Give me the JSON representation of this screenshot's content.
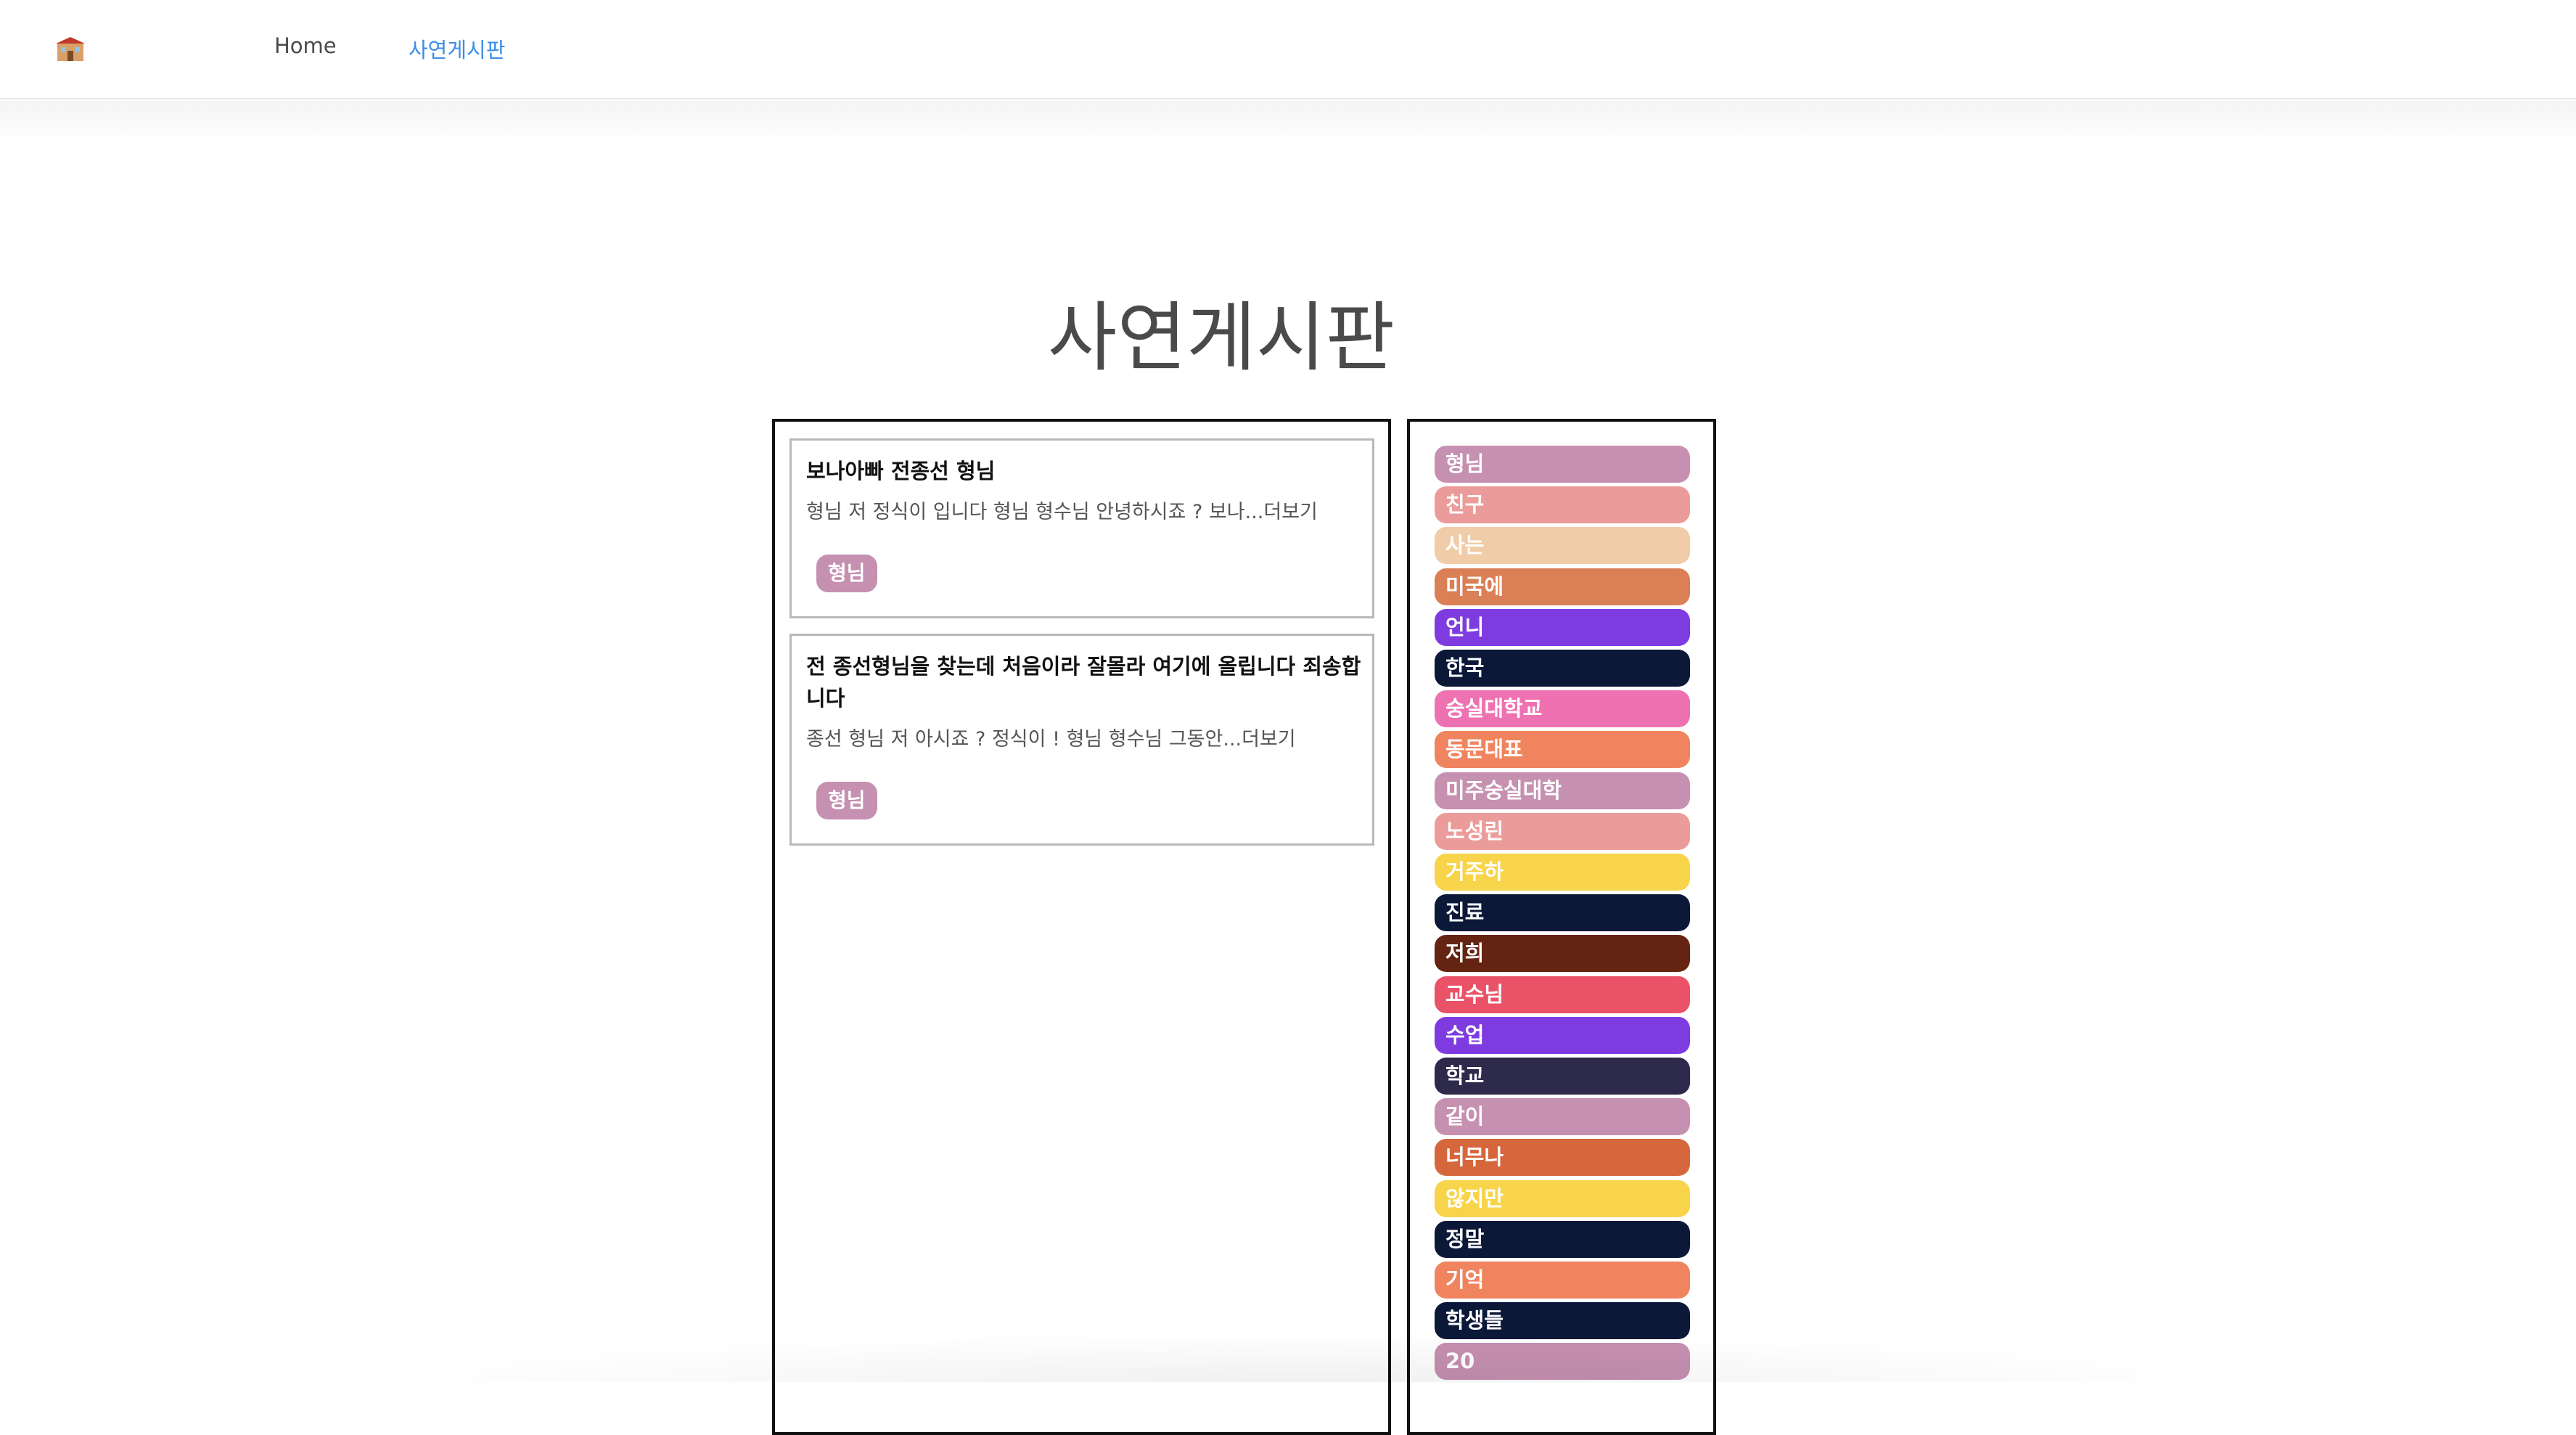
{
  "nav": {
    "logo_icon": "house-icon",
    "links": [
      "Home",
      "사연게시판"
    ],
    "active_color": "#3a8ee6"
  },
  "page": {
    "title": "사연게시판"
  },
  "posts": [
    {
      "title": "보나아빠 전종선 형님",
      "excerpt": "형님 저 정식이 입니다 형님 형수님 안녕하시죠 ? 보나...더보기",
      "tag": "형님"
    },
    {
      "title": "전 종선형님을 찾는데 처음이라 잘몰라 여기에 올립니다 죄송합니다",
      "excerpt": "종선 형님 저 아시죠 ? 정식이 ! 형님 형수님 그동안...더보기",
      "tag": "형님"
    }
  ],
  "tags": [
    {
      "label": "형님",
      "color": "#c690b0"
    },
    {
      "label": "친구",
      "color": "#eb9c9a"
    },
    {
      "label": "사는",
      "color": "#f0cca8"
    },
    {
      "label": "미국에",
      "color": "#da7f56"
    },
    {
      "label": "언니",
      "color": "#7e3ce0"
    },
    {
      "label": "한국",
      "color": "#0b1838"
    },
    {
      "label": "숭실대학교",
      "color": "#ee72b2"
    },
    {
      "label": "동문대표",
      "color": "#f0845e"
    },
    {
      "label": "미주숭실대학",
      "color": "#c690b0"
    },
    {
      "label": "노성린",
      "color": "#eb9c9a"
    },
    {
      "label": "거주하",
      "color": "#f8d44a"
    },
    {
      "label": "진료",
      "color": "#0b1838"
    },
    {
      "label": "저희",
      "color": "#652412"
    },
    {
      "label": "교수님",
      "color": "#ea5268"
    },
    {
      "label": "수업",
      "color": "#7e3ce0"
    },
    {
      "label": "학교",
      "color": "#2e2a4c"
    },
    {
      "label": "같이",
      "color": "#c690b0"
    },
    {
      "label": "너무나",
      "color": "#d6673c"
    },
    {
      "label": "않지만",
      "color": "#f8d44a"
    },
    {
      "label": "정말",
      "color": "#0b1838"
    },
    {
      "label": "기억",
      "color": "#f0845e"
    },
    {
      "label": "학생들",
      "color": "#0b1838"
    },
    {
      "label": "20",
      "color": "#c690b0"
    }
  ]
}
